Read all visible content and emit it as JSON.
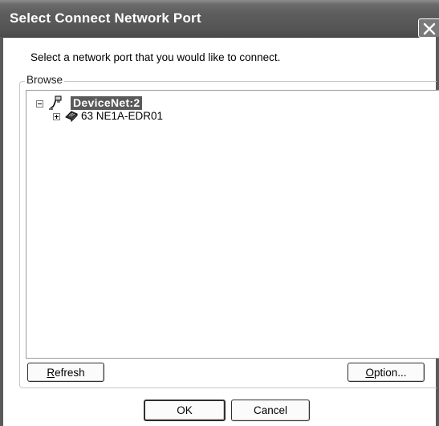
{
  "window": {
    "title": "Select Connect Network Port"
  },
  "prompt_text": "Select a network port that you would like to connect.",
  "browse_group": {
    "label": "Browse"
  },
  "tree": {
    "nodes": [
      {
        "label": "DeviceNet:2",
        "expanded": true,
        "selected": true,
        "icon": "network-icon"
      },
      {
        "label": "63 NE1A-EDR01",
        "expanded": false,
        "selected": false,
        "icon": "device-icon"
      }
    ]
  },
  "buttons": {
    "refresh": {
      "mnemonic": "R",
      "rest": "efresh"
    },
    "option": {
      "mnemonic": "O",
      "rest": "ption..."
    },
    "ok": "OK",
    "cancel": "Cancel"
  }
}
